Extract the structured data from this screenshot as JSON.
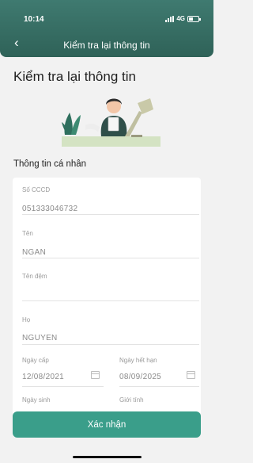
{
  "status": {
    "time": "10:14",
    "network": "4G"
  },
  "header": {
    "title": "Kiểm tra lại thông tin"
  },
  "page": {
    "title": "Kiểm tra lại thông tin",
    "section_title": "Thông tin cá nhân"
  },
  "form": {
    "so_cccd": {
      "label": "Số CCCD",
      "value": "051333046732"
    },
    "ten": {
      "label": "Tên",
      "value": "NGAN"
    },
    "ten_dem": {
      "label": "Tên đệm",
      "value": ""
    },
    "ho": {
      "label": "Họ",
      "value": "NGUYEN"
    },
    "ngay_cap": {
      "label": "Ngày cấp",
      "value": "12/08/2021"
    },
    "ngay_het_han": {
      "label": "Ngày hết hạn",
      "value": "08/09/2025"
    },
    "ngay_sinh": {
      "label": "Ngày sinh",
      "value": ""
    },
    "gioi_tinh": {
      "label": "Giới tính",
      "value": ""
    }
  },
  "actions": {
    "confirm_label": "Xác nhận"
  },
  "colors": {
    "header": "#2f6258",
    "accent": "#3a9e8a",
    "background": "#f2f2f2"
  },
  "icons": {
    "back": "chevron-left-icon",
    "calendar": "calendar-icon"
  }
}
